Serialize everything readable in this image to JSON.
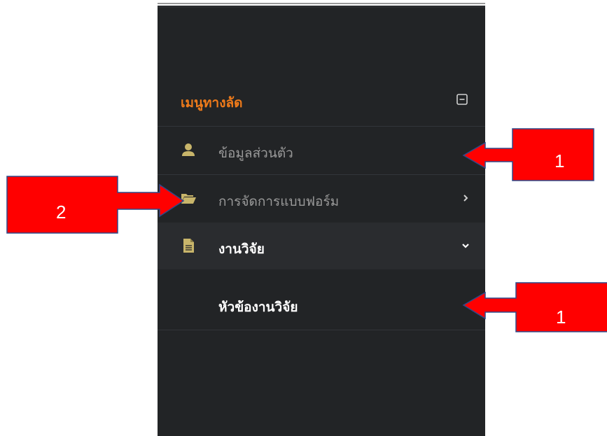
{
  "sidebar": {
    "title": "เมนูทางลัด",
    "title_color": "#f07b1a",
    "collapse_icon": "minus-square-icon",
    "items": [
      {
        "label": "ข้อมูลส่วนตัว",
        "icon": "user-icon"
      },
      {
        "label": "การจัดการแบบฟอร์ม",
        "icon": "folder-open-icon",
        "chevron": "chevron-right-icon"
      },
      {
        "label": "งานวิจัย",
        "icon": "document-icon",
        "chevron": "chevron-down-icon",
        "expanded": true,
        "children": [
          {
            "label": "หัวข้องานวิจัย"
          }
        ]
      }
    ]
  },
  "annotations": [
    {
      "label": "1",
      "direction": "left",
      "color": "#ff0000"
    },
    {
      "label": "2",
      "direction": "right",
      "color": "#ff0000"
    },
    {
      "label": "1",
      "direction": "left",
      "color": "#ff0000"
    }
  ]
}
